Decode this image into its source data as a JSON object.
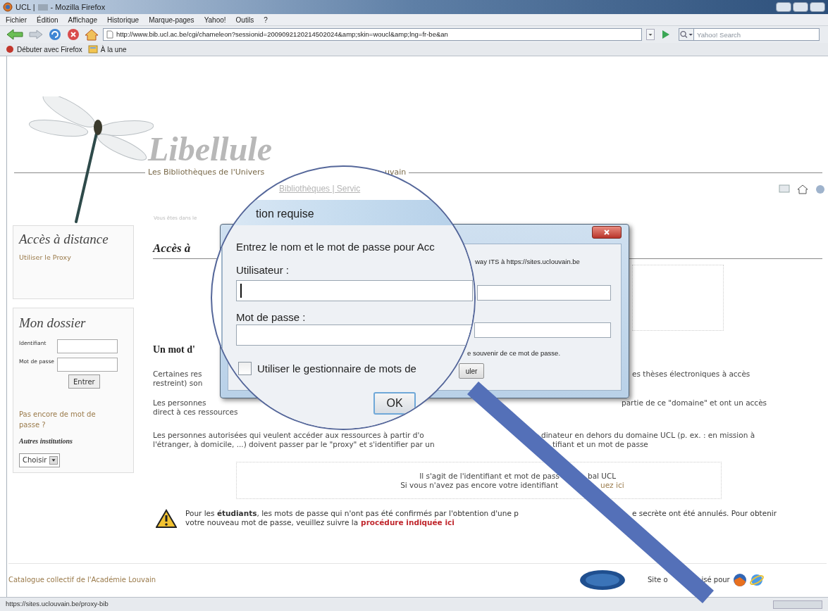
{
  "window": {
    "title": "UCL |",
    "title_suffix": "- Mozilla Firefox"
  },
  "menu": [
    {
      "label": "Fichier"
    },
    {
      "label": "Édition"
    },
    {
      "label": "Affichage"
    },
    {
      "label": "Historique"
    },
    {
      "label": "Marque-pages"
    },
    {
      "label": "Yahoo!"
    },
    {
      "label": "Outils"
    },
    {
      "label": "?"
    }
  ],
  "navigation": {
    "url": "http://www.bib.ucl.ac.be/cgi/chameleon?sessionid=2009092120214502024&amp;skin=woucl&amp;lng=fr-be&an",
    "search_placeholder": "Yahoo! Search"
  },
  "bookmarks": [
    {
      "label": "Débuter avec Firefox"
    },
    {
      "label": "À la une"
    }
  ],
  "header": {
    "logo": "Libellule",
    "subtitle": "Les Bibliothèques de l'Univers",
    "subtitle_end": "uvain",
    "breadcrumb": "Vous êtes dans le"
  },
  "sidebar": {
    "remote": {
      "title": "Accès à distance",
      "link": "Utiliser le Proxy"
    },
    "account": {
      "title": "Mon dossier",
      "fields": [
        {
          "label": "Identifiant"
        },
        {
          "label": "Mot de passe"
        }
      ],
      "button": "Entrer",
      "link": "Pas encore de mot de passe ?",
      "institutions_title": "Autres institutions",
      "select": "Choisir"
    }
  },
  "main": {
    "heading": "Accès à",
    "section_heading": "Un mot d'",
    "paragraphs": [
      {
        "lines": [
          {
            "left": "Certaines res",
            "right": "es thèses électroniques à accès"
          },
          {
            "left": "restreint) son"
          }
        ]
      },
      {
        "lines": [
          {
            "left": "Les personnes",
            "right": "partie de ce \"domaine\" et ont un accès"
          },
          {
            "left": "direct à ces ressources"
          }
        ]
      },
      {
        "lines": [
          {
            "left": "Les personnes autorisées qui veulent accéder aux ressources à partir d'o",
            "right": "dinateur en dehors du domaine UCL (p. ex. : en mission à"
          },
          {
            "left": "l'étranger, à domicile, ...) doivent passer par le \"proxy\" et s'identifier par un",
            "right": "tifiant et un mot de passe"
          }
        ]
      }
    ],
    "info_box": [
      {
        "left": "Il s'agit de l'identifiant et mot de pass",
        "right": "bal UCL"
      },
      {
        "left": "Si vous n'avez pas encore votre identifiant",
        "right": "uez ici"
      }
    ],
    "warning": {
      "line1_left": "Pour les **étudiants**, les mots de passe qui n'ont pas été confirmés par l'obtention d'une p",
      "line1_right": "e secrète ont été annulés. Pour obtenir",
      "line2": "votre nouveau mot de passe, veuillez suivre la",
      "link": "procédure indiquée ici"
    }
  },
  "footer": {
    "catalogue": "Catalogue collectif de l'Académie Louvain",
    "browsers_start": "Site o",
    "browsers_end": "isé pour"
  },
  "status_bar": "https://sites.uclouvain.be/proxy-bib",
  "dialog": {
    "message_end": "way ITS à https://sites.uclouvain.be",
    "remember_end": "e souvenir de ce mot de passe.",
    "cancel_end": "uler"
  },
  "magnifier": {
    "nav_text": "Bibliothèques | Servic",
    "title": "tion requise",
    "message": "Entrez le nom et le mot de passe pour Acc",
    "user_label": "Utilisateur :",
    "user_focused": true,
    "password_label": "Mot de passe :",
    "manager": {
      "label": "Utiliser le gestionnaire de mots de",
      "checked": false
    },
    "ok": "OK"
  }
}
